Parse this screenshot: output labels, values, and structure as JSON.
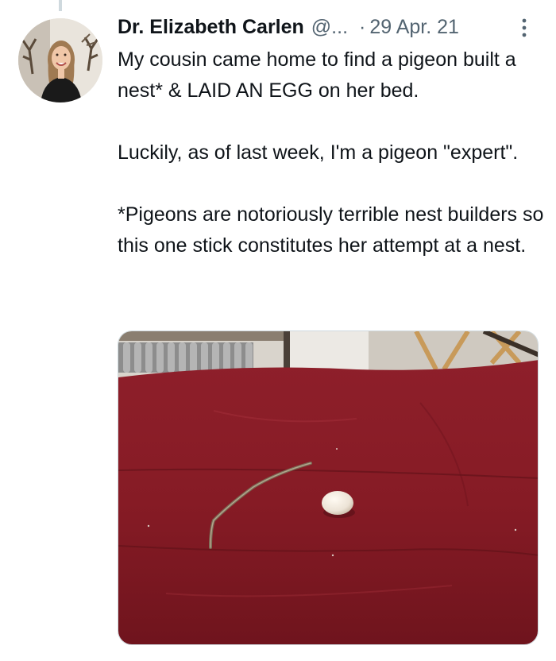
{
  "tweet": {
    "author": {
      "display_name": "Dr. Elizabeth Carlen",
      "handle": "@..."
    },
    "separator": "·",
    "date": "29 Apr. 21",
    "paragraphs": [
      "My cousin came home to find a pigeon built a nest* & LAID AN EGG on her bed.",
      "Luckily, as of last week, I'm a pigeon \"expert\".",
      "*Pigeons are notoriously terrible nest builders so this one stick constitutes her attempt at a nest."
    ]
  },
  "icons": {
    "more": "more-vertical-icon"
  },
  "colors": {
    "text": "#0f1419",
    "secondary_text": "#536471",
    "border": "#cfd9de",
    "blanket": "#8a1c25"
  }
}
